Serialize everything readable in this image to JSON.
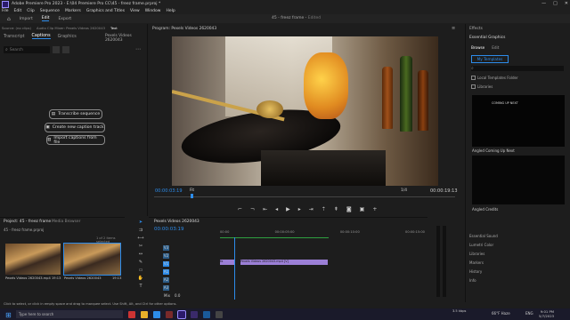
{
  "window": {
    "title": "Adobe Premiere Pro 2023 - E:\\04 Premiere Pro CC\\45 - freez frame.prproj *",
    "min": "—",
    "max": "□",
    "close": "✕"
  },
  "menu": [
    "File",
    "Edit",
    "Clip",
    "Sequence",
    "Markers",
    "Graphics and Titles",
    "View",
    "Window",
    "Help"
  ],
  "workspace": {
    "home": "⌂",
    "tabs": [
      "Import",
      "Edit",
      "Export"
    ],
    "active": "Edit",
    "project_name": "45 - freez frame",
    "edited": "Edited"
  },
  "text_panel": {
    "tabs": [
      "Transcript",
      "Captions",
      "Graphics"
    ],
    "active_tab": "Captions",
    "source": "Source: (no clips)",
    "audio_clip": "Audio Clip Mixer: Pexels Videos 2620043",
    "text_tab": "Text",
    "sequence": "Pexels Videos 2620043",
    "search_placeholder": "Search",
    "buttons": [
      "Transcribe sequence",
      "Create new caption track",
      "Import captions from file"
    ]
  },
  "program": {
    "title": "Program: Pexels Videos 2620043",
    "timecode_left": "00:00:03:19",
    "fit": "Fit",
    "quality": "1/4",
    "timecode_right": "00:00:19:13"
  },
  "project": {
    "title": "Project: 45 - freez frame",
    "media_browser": "Media Browser",
    "file": "45 - freez frame.prproj",
    "count": "1 of 2 items selected",
    "items": [
      {
        "name": "Pexels Videos 2620043.mp4",
        "dur": "19:13"
      },
      {
        "name": "Pexels Videos 2620043",
        "dur": "19:13"
      }
    ]
  },
  "timeline": {
    "title": "Pexels Videos 2620043",
    "timecode": "00:00:03:19",
    "ruler": [
      "00:00",
      "00:00:05:00",
      "00:00:10:00",
      "00:00:15:00"
    ],
    "tracks": [
      "V3",
      "V2",
      "V1",
      "A1",
      "A2",
      "A3",
      "Mix"
    ],
    "clip_label": "Pexels Videos 2620043.mp4 [V]",
    "clip_fx": "fx",
    "mix_value": "0.0"
  },
  "essential_graphics": {
    "title": "Essential Graphics",
    "tabs": [
      "Browse",
      "Edit"
    ],
    "my_templates": "My Templates",
    "search": "⌕",
    "local_templates": "Local Templates Folder",
    "libraries": "Libraries",
    "template1_preview": "COMING UP NEXT",
    "template1": "Angled Coming Up Next",
    "template2": "Angled Credits",
    "panels": [
      "Essential Sound",
      "Lumetri Color",
      "Libraries",
      "Markers",
      "History",
      "Info"
    ]
  },
  "statusbar": {
    "hint": "Click to select, or click in empty space and drag to marquee select. Use Shift, Alt, and Ctrl for other options."
  },
  "taskbar": {
    "search": "Type here to search",
    "net": "3.5 kbps",
    "temp": "66°F",
    "weather": "Haze",
    "time": "9:01 PM",
    "date": "5/7/2023",
    "lang": "ENG"
  },
  "colors": {
    "accent": "#2d8ceb",
    "clip": "#9b7fd6",
    "playhead": "#2d8ceb",
    "taskbar": "#1a1a2a"
  }
}
